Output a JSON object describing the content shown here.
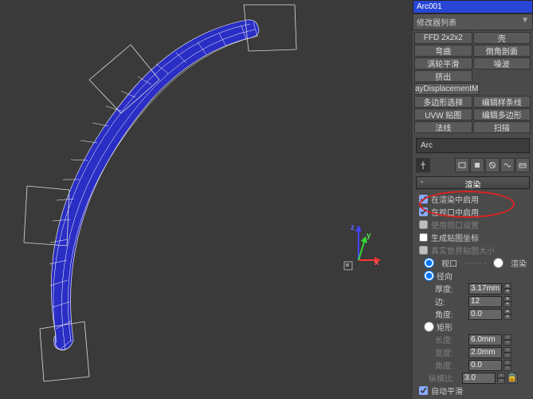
{
  "obj": {
    "name": "Arc001"
  },
  "mod_list_label": "修改器列表",
  "mods": [
    "FFD 2x2x2",
    "壳",
    "弯曲",
    "倒角剖面",
    "涡轮平滑",
    "噪波",
    "挤出",
    "ayDisplacementM",
    "多边形选择",
    "编辑样条线",
    "UVW 贴图",
    "编辑多边形",
    "法线",
    "扫描"
  ],
  "stack_item": "Arc",
  "rollouts": {
    "render": "渲染"
  },
  "r": {
    "en_render": "在渲染中启用",
    "en_viewport": "在视口中启用",
    "use_viewport": "使用视口设置",
    "gen_map": "生成贴图坐标",
    "real_world": "真实世界贴图大小",
    "viewport": "视口",
    "rend": "渲染",
    "radial": "径向",
    "thickness": "厚度:",
    "sides": "边:",
    "angle": "角度:",
    "rect": "矩形",
    "length": "长度:",
    "width": "宽度:",
    "angle2": "角度:",
    "aspect": "纵横比:",
    "autosmooth": "自动平滑"
  },
  "v": {
    "thickness": "3.17mm",
    "sides": "12",
    "angle": "0.0",
    "length": "6.0mm",
    "width": "2.0mm",
    "angle2": "0.0",
    "aspect": "3.0"
  },
  "axes": {
    "x": "x",
    "y": "y",
    "z": "z"
  }
}
